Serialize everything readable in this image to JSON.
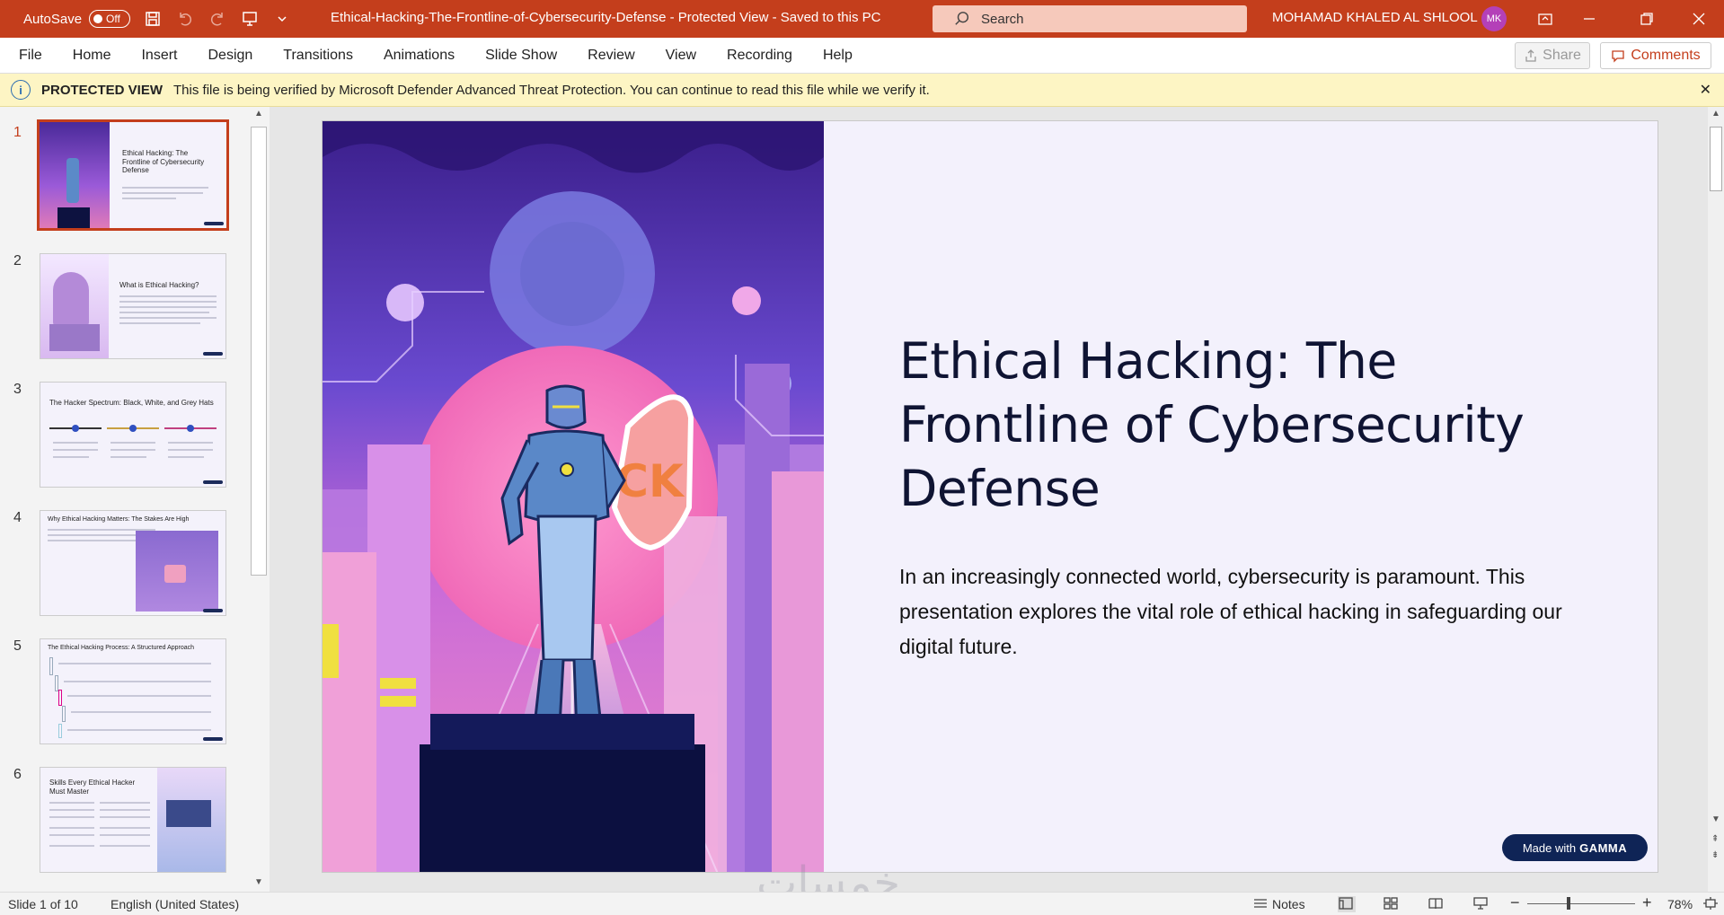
{
  "titlebar": {
    "autosave_label": "AutoSave",
    "autosave_state": "Off",
    "document_title": "Ethical-Hacking-The-Frontline-of-Cybersecurity-Defense  -  Protected View  -  Saved to this PC",
    "search_placeholder": "Search",
    "user_name": "MOHAMAD KHALED AL SHLOOL",
    "user_initials": "MK"
  },
  "menu": {
    "items": [
      "File",
      "Home",
      "Insert",
      "Design",
      "Transitions",
      "Animations",
      "Slide Show",
      "Review",
      "View",
      "Recording",
      "Help"
    ],
    "share_label": "Share",
    "comments_label": "Comments"
  },
  "protected_view": {
    "label": "PROTECTED VIEW",
    "message": "This file is being verified by Microsoft Defender Advanced Threat Protection. You can continue to read this file while we verify it.",
    "close": "✕"
  },
  "thumbnails": [
    {
      "num": "1",
      "title": "Ethical Hacking: The Frontline of Cybersecurity Defense"
    },
    {
      "num": "2",
      "title": "What is Ethical Hacking?"
    },
    {
      "num": "3",
      "title": "The Hacker Spectrum: Black, White, and Grey Hats"
    },
    {
      "num": "4",
      "title": "Why Ethical Hacking Matters: The Stakes Are High"
    },
    {
      "num": "5",
      "title": "The Ethical Hacking Process: A Structured Approach"
    },
    {
      "num": "6",
      "title": "Skills Every Ethical Hacker Must Master"
    }
  ],
  "slide": {
    "title": "Ethical Hacking: The Frontline of Cybersecurity Defense",
    "body": "In an increasingly connected world, cybersecurity is paramount. This presentation explores the vital role of ethical hacking in safeguarding our digital future.",
    "shield_text": "CK",
    "gamma_badge_prefix": "Made with",
    "gamma_badge_brand": "GAMMA"
  },
  "watermark": "خمسات",
  "status": {
    "slide_counter": "Slide 1 of 10",
    "language": "English (United States)",
    "notes_label": "Notes",
    "zoom": "78%"
  },
  "colors": {
    "accent": "#c43e1c",
    "protected_bg": "#fdf5c4",
    "slide_bg": "#f3f1fc",
    "title_text": "#0f1433",
    "gamma_badge": "#0f2456"
  }
}
